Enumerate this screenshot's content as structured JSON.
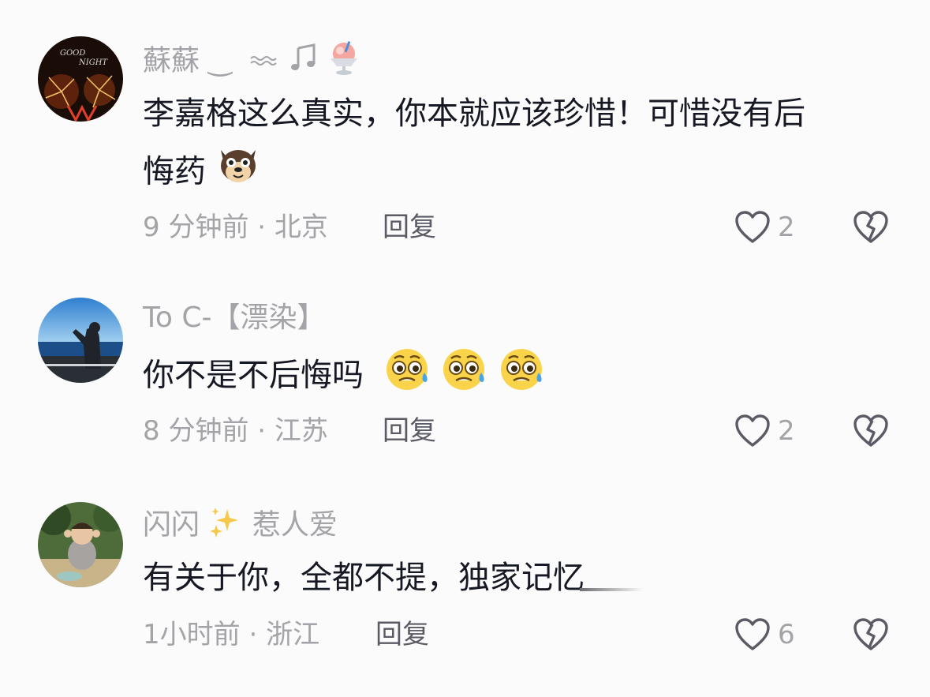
{
  "comments": [
    {
      "username": "蘇蘇 ‿ ︎",
      "username_suffix_icons": [
        "wave-icon",
        "music-note-icon",
        "shaved-ice-icon"
      ],
      "text_line1": "李嘉格这么真实，你本就应该珍惜！可惜没有后",
      "text_line2": "悔药",
      "emoji": "dog-face-icon",
      "time": "9 分钟前",
      "location": "北京",
      "reply_label": "回复",
      "likes": "2"
    },
    {
      "username": "To C-【漂染】",
      "text": "你不是不后悔吗",
      "emoji": "pleading-sweat-face-icon",
      "time": "8 分钟前",
      "location": "江苏",
      "reply_label": "回复",
      "likes": "2"
    },
    {
      "username_a": "闪闪",
      "username_b": "惹人爱",
      "username_icon": "sparkles-icon",
      "text": "有关于你，全都不提，独家记忆",
      "time": "1小时前",
      "location": "浙江",
      "reply_label": "回复",
      "likes": "6"
    }
  ],
  "separator": " · ",
  "colors": {
    "primary_text": "#161823",
    "secondary_text": "#a3a3a8",
    "reply_text": "#5a5b64",
    "icon_stroke": "#5a5b64",
    "background": "#fbfbfb"
  }
}
